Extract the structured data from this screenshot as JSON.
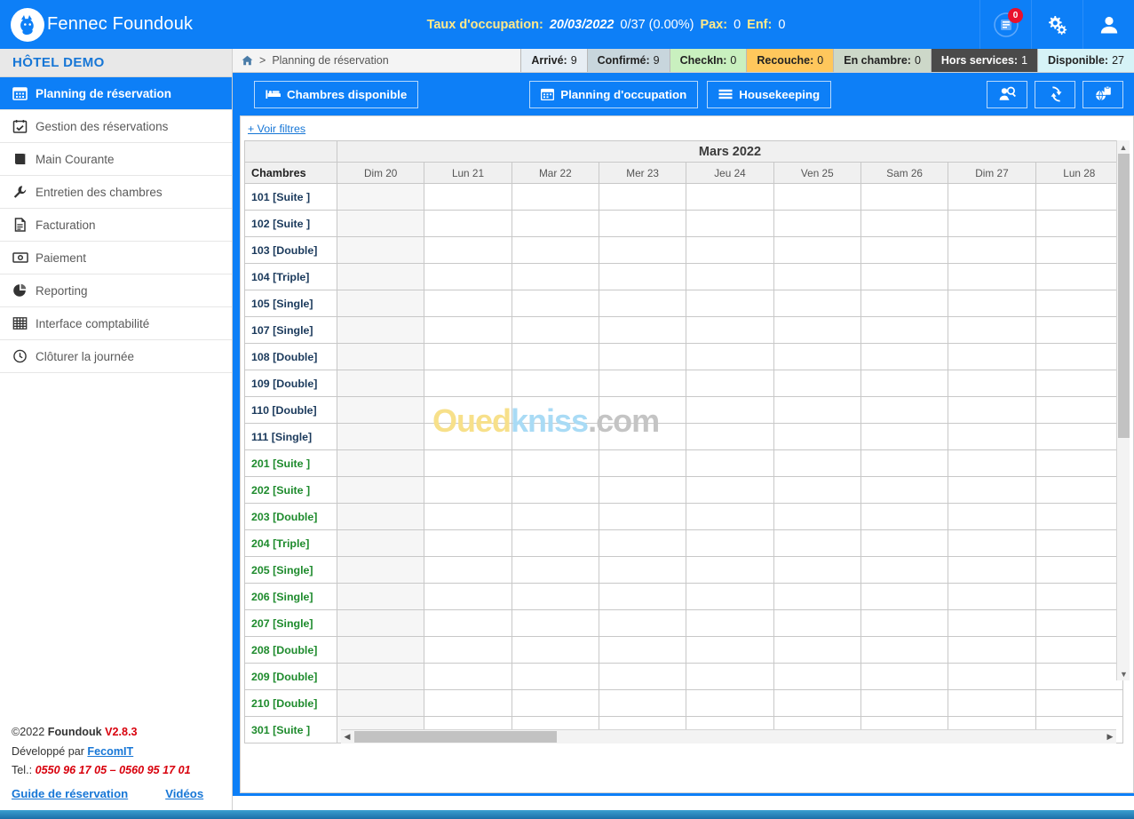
{
  "topbar": {
    "brand": "Fennec Foundouk",
    "logo_icon": "fennec-logo-icon",
    "occupancy": {
      "label": "Taux d'occupation:",
      "date": "20/03/2022",
      "ratio": "0/37 (0.00%)",
      "pax_label": "Pax:",
      "pax_value": "0",
      "enf_label": "Enf:",
      "enf_value": "0"
    },
    "icons": [
      {
        "name": "book-icon",
        "badge": "0"
      },
      {
        "name": "gears-icon",
        "badge": ""
      },
      {
        "name": "user-icon",
        "badge": ""
      }
    ]
  },
  "sidebar": {
    "hotel_name": "HÔTEL DEMO",
    "items": [
      {
        "label": "Planning de réservation",
        "icon": "calendar-grid-icon",
        "active": true
      },
      {
        "label": "Gestion des réservations",
        "icon": "calendar-check-icon",
        "active": false
      },
      {
        "label": "Main Courante",
        "icon": "book-open-icon",
        "active": false
      },
      {
        "label": "Entretien des chambres",
        "icon": "wrench-icon",
        "active": false
      },
      {
        "label": "Facturation",
        "icon": "invoice-icon",
        "active": false
      },
      {
        "label": "Paiement",
        "icon": "money-icon",
        "active": false
      },
      {
        "label": "Reporting",
        "icon": "pie-chart-icon",
        "active": false
      },
      {
        "label": "Interface comptabilité",
        "icon": "table-grid-icon",
        "active": false
      },
      {
        "label": "Clôturer la journée",
        "icon": "clock-icon",
        "active": false
      }
    ],
    "footer": {
      "copyright_prefix": "©2022",
      "copyright_name": "Foundouk",
      "version": "V2.8.3",
      "dev_prefix": "Développé par",
      "dev_company": "FecomIT",
      "tel_label": "Tel.:",
      "tel_value": "0550 96 17 05 – 0560 95 17 01",
      "link_guide": "Guide de réservation",
      "link_videos": "Vidéos"
    }
  },
  "breadcrumb": {
    "home_icon": "home-icon",
    "separator": ">",
    "current": "Planning de réservation"
  },
  "stats": [
    {
      "label": "Arrivé:",
      "value": "9",
      "bg": "#e7eef4",
      "fg": "#222222"
    },
    {
      "label": "Confirmé:",
      "value": "9",
      "bg": "#c8d6dd",
      "fg": "#222222"
    },
    {
      "label": "CheckIn:",
      "value": "0",
      "bg": "#c9f0bf",
      "fg": "#222222"
    },
    {
      "label": "Recouche:",
      "value": "0",
      "bg": "#ffc75c",
      "fg": "#222222"
    },
    {
      "label": "En chambre:",
      "value": "0",
      "bg": "#cdd8c9",
      "fg": "#222222"
    },
    {
      "label": "Hors services:",
      "value": "1",
      "bg": "#4a4a4a",
      "fg": "#ffffff"
    },
    {
      "label": "Disponible:",
      "value": "27",
      "bg": "#d6f3f7",
      "fg": "#222222"
    }
  ],
  "toolbar": {
    "buttons": [
      {
        "label": "Chambres disponible",
        "icon": "bed-icon"
      },
      {
        "label": "Planning d'occupation",
        "icon": "calendar-icon"
      },
      {
        "label": "Housekeeping",
        "icon": "list-bars-icon"
      }
    ],
    "icon_buttons": [
      {
        "name": "user-search-icon"
      },
      {
        "name": "refresh-icon"
      },
      {
        "name": "globe-clipboard-icon"
      }
    ]
  },
  "planning": {
    "filters_link": "+ Voir filtres",
    "month_title": "Mars 2022",
    "rooms_header": "Chambres",
    "days": [
      "Dim 20",
      "Lun 21",
      "Mar 22",
      "Mer 23",
      "Jeu 24",
      "Ven 25",
      "Sam 26",
      "Dim 27",
      "Lun 28"
    ],
    "rows": [
      {
        "room": "101 [Suite ]",
        "color": "navy"
      },
      {
        "room": "102 [Suite ]",
        "color": "navy"
      },
      {
        "room": "103 [Double]",
        "color": "navy"
      },
      {
        "room": "104 [Triple]",
        "color": "navy"
      },
      {
        "room": "105 [Single]",
        "color": "navy"
      },
      {
        "room": "107 [Single]",
        "color": "navy"
      },
      {
        "room": "108 [Double]",
        "color": "navy"
      },
      {
        "room": "109 [Double]",
        "color": "navy"
      },
      {
        "room": "110 [Double]",
        "color": "navy"
      },
      {
        "room": "111 [Single]",
        "color": "navy"
      },
      {
        "room": "201 [Suite ]",
        "color": "green"
      },
      {
        "room": "202 [Suite ]",
        "color": "green"
      },
      {
        "room": "203 [Double]",
        "color": "green"
      },
      {
        "room": "204 [Triple]",
        "color": "green"
      },
      {
        "room": "205 [Single]",
        "color": "green"
      },
      {
        "room": "206 [Single]",
        "color": "green"
      },
      {
        "room": "207 [Single]",
        "color": "green"
      },
      {
        "room": "208 [Double]",
        "color": "green"
      },
      {
        "room": "209 [Double]",
        "color": "green"
      },
      {
        "room": "210 [Double]",
        "color": "green"
      },
      {
        "room": "301 [Suite ]",
        "color": "green"
      }
    ]
  },
  "watermark": {
    "part1": "Oued",
    "part2": "kniss",
    "part3": ".com"
  }
}
